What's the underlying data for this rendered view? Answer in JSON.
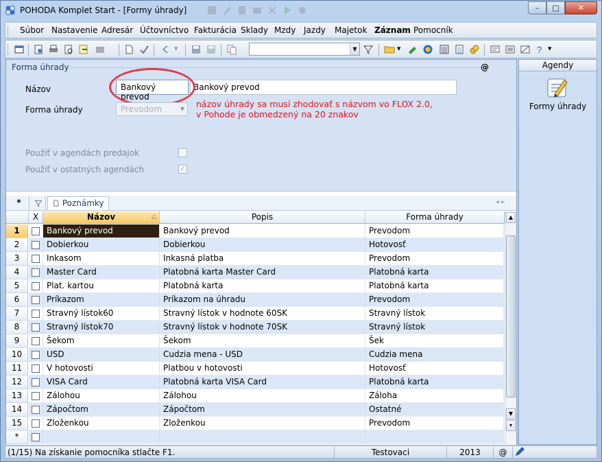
{
  "window": {
    "title": "POHODA Komplet Start - [Formy úhrady]",
    "controls": {
      "minimize": "–",
      "maximize": "□",
      "close": "✕"
    }
  },
  "menu": {
    "items": [
      "Súbor",
      "Nastavenie",
      "Adresár",
      "Účtovníctvo",
      "Fakturácia",
      "Sklady",
      "Mzdy",
      "Jazdy",
      "Majetok",
      "Záznam",
      "Pomocník"
    ]
  },
  "toolbar": {
    "combo_value": "",
    "icons": [
      "window-icon",
      "open-icon",
      "print-icon",
      "print-preview-icon",
      "export-icon",
      "document-icon",
      "check-icon",
      "back-icon",
      "save-icon",
      "save-disabled-icon",
      "copy-icon",
      "filter-icon",
      "folder-icon",
      "edit-icon",
      "euro-icon",
      "calculator-icon",
      "calendar-icon",
      "coins-icon",
      "message-icon",
      "list-icon",
      "report-icon",
      "help-icon"
    ]
  },
  "form": {
    "legend": "Forma úhrady",
    "at_symbol": "@",
    "name_label": "Názov",
    "name_value": "Bankový prevod",
    "description_value": "Bankový prevod",
    "payment_form_label": "Forma úhrady",
    "payment_form_value": "Prevodom",
    "annotation_line1": "názov úhrady sa musí zhodovať s názvom vo FLOX 2.0,",
    "annotation_line2": "v Pohode je obmedzený na 20 znakov",
    "use_sales_label": "Použiť v agendách predajok",
    "use_sales_checked": false,
    "use_other_label": "Použiť v ostatných agendách",
    "use_other_checked": true
  },
  "grid_tabs": {
    "star": "*",
    "notes": "Poznámky",
    "nav": "◂ ▸"
  },
  "grid": {
    "columns": {
      "x": "X",
      "name": "Názov",
      "description": "Popis",
      "form": "Forma úhrady"
    },
    "rows": [
      {
        "num": "1",
        "name": "Bankový prevod",
        "description": "Bankový prevod",
        "form": "Prevodom"
      },
      {
        "num": "2",
        "name": "Dobierkou",
        "description": "Dobierkou",
        "form": "Hotovosť"
      },
      {
        "num": "3",
        "name": "Inkasom",
        "description": "Inkasná platba",
        "form": "Prevodom"
      },
      {
        "num": "4",
        "name": "Master Card",
        "description": "Platobná karta Master Card",
        "form": "Platobná karta"
      },
      {
        "num": "5",
        "name": "Plat. kartou",
        "description": "Platobná karta",
        "form": "Platobná karta"
      },
      {
        "num": "6",
        "name": "Príkazom",
        "description": "Príkazom na úhradu",
        "form": "Prevodom"
      },
      {
        "num": "7",
        "name": "Stravný lístok60",
        "description": "Stravný lístok v hodnote 60SK",
        "form": "Stravný lístok"
      },
      {
        "num": "8",
        "name": "Stravný lístok70",
        "description": "Stravný lístok v hodnote 70SK",
        "form": "Stravný lístok"
      },
      {
        "num": "9",
        "name": "Šekom",
        "description": "Šekom",
        "form": "Šek"
      },
      {
        "num": "10",
        "name": "USD",
        "description": "Cudzia mena - USD",
        "form": "Cudzia mena"
      },
      {
        "num": "11",
        "name": "V hotovosti",
        "description": "Platbou v hotovosti",
        "form": "Hotovosť"
      },
      {
        "num": "12",
        "name": "VISA Card",
        "description": "Platobná karta VISA Card",
        "form": "Platobná karta"
      },
      {
        "num": "13",
        "name": "Zálohou",
        "description": "Zálohou",
        "form": "Záloha"
      },
      {
        "num": "14",
        "name": "Zápočtom",
        "description": "Zápočtom",
        "form": "Ostatné"
      },
      {
        "num": "15",
        "name": "Zloženkou",
        "description": "Zloženkou",
        "form": "Prevodom"
      },
      {
        "num": "*",
        "name": "",
        "description": "",
        "form": ""
      }
    ]
  },
  "agenda": {
    "header": "Agendy",
    "item_label": "Formy úhrady"
  },
  "statusbar": {
    "record": "(1/15) Na získanie pomocníka stlačte F1.",
    "company": "Testovaci",
    "year": "2013",
    "at": "@"
  },
  "colors": {
    "annotation": "#e0141c",
    "highlight": "#e23c4a",
    "selected_row": "#2f1f10",
    "alt_row": "#dbe7f7"
  }
}
